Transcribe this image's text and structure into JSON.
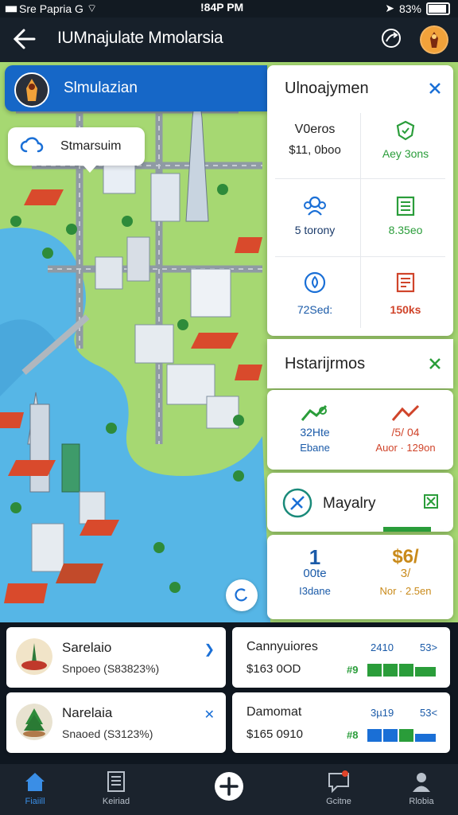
{
  "status": {
    "left_text": "Sre Papria G",
    "time": "!84P PM",
    "battery": "83%",
    "battery_level": 0.83
  },
  "header": {
    "title": "IUMnajulate Mmolarsia"
  },
  "banner": {
    "title": "Slmulazian"
  },
  "bubble": {
    "text": "Stmarsuim"
  },
  "panel1": {
    "title": "Ulnoajymen",
    "cells": [
      {
        "label": "V0eros",
        "value": "$11, 0boo",
        "color": "#222222"
      },
      {
        "label": "Aey 3ons",
        "value": "",
        "color": "#2a9d3a"
      },
      {
        "label": "5 torony",
        "value": "",
        "color": "#1a5aa8"
      },
      {
        "label": "8.35eo",
        "value": "",
        "color": "#2a9d3a"
      },
      {
        "label": "72Sed:",
        "value": "",
        "color": "#1a5aa8"
      },
      {
        "label": "150ks",
        "value": "",
        "color": "#d0442a"
      }
    ]
  },
  "panel2": {
    "title": "Hstarijrmos",
    "items": [
      {
        "big": "32Hte",
        "small": "Ebane",
        "color": "#1a5aa8"
      },
      {
        "big": "/5/ 04",
        "small": "Auor · 129on",
        "color": "#d0442a"
      }
    ]
  },
  "panel3": {
    "title": "Mayalry"
  },
  "panel4": {
    "items": [
      {
        "big": "1",
        "mid": "00te",
        "small": "I3dane",
        "color": "#1a5aa8"
      },
      {
        "big": "$6/",
        "mid": "3/",
        "small": "Nor · 2.5en",
        "color": "#c98a1a"
      }
    ]
  },
  "cards": [
    {
      "title": "Sarelaio",
      "sub": "Snpoeo (S83823%)"
    },
    {
      "title": "Cannyuiores",
      "sub": "$163 0OD",
      "a": "2410",
      "b": "53>",
      "c": "#9"
    },
    {
      "title": "Narelaia",
      "sub": "Snaoed (S3123%)"
    },
    {
      "title": "Damomat",
      "sub": "$165 0910",
      "a": "3µ19",
      "b": "53<",
      "c": "#8"
    }
  ],
  "nav": [
    {
      "label": "Fiaiill",
      "icon": "home-icon",
      "active": true
    },
    {
      "label": "Keiriad",
      "icon": "document-icon"
    },
    {
      "label": "",
      "icon": "add-icon"
    },
    {
      "label": "Gcitne",
      "icon": "chat-icon"
    },
    {
      "label": "Rlobia",
      "icon": "profile-icon"
    }
  ],
  "colors": {
    "accent": "#1a6fd6",
    "green": "#2a9d3a",
    "water": "#56b6e6",
    "land": "#9fd36a"
  }
}
